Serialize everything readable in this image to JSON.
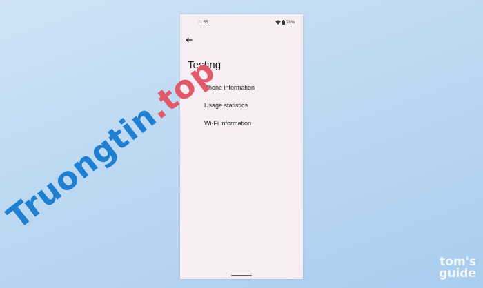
{
  "status_bar": {
    "time": "11:55",
    "battery": "78%",
    "icons": [
      "wifi-icon",
      "battery-icon"
    ]
  },
  "header": {
    "back_icon": "back-arrow-icon",
    "title": "Testing"
  },
  "menu": {
    "items": [
      {
        "label": "Phone information"
      },
      {
        "label": "Usage statistics"
      },
      {
        "label": "Wi-Fi information"
      }
    ]
  },
  "overlay": {
    "watermark_name": "Truongtin",
    "watermark_dot": ".",
    "watermark_tld": "top",
    "brand_line1": "tom's",
    "brand_line2": "guide"
  },
  "colors": {
    "background": "#bcd8f2",
    "screen": "#f6eef3",
    "text": "#1e1e1e",
    "watermark_blue": "#1f7fd0",
    "watermark_red": "#e05a6a"
  }
}
